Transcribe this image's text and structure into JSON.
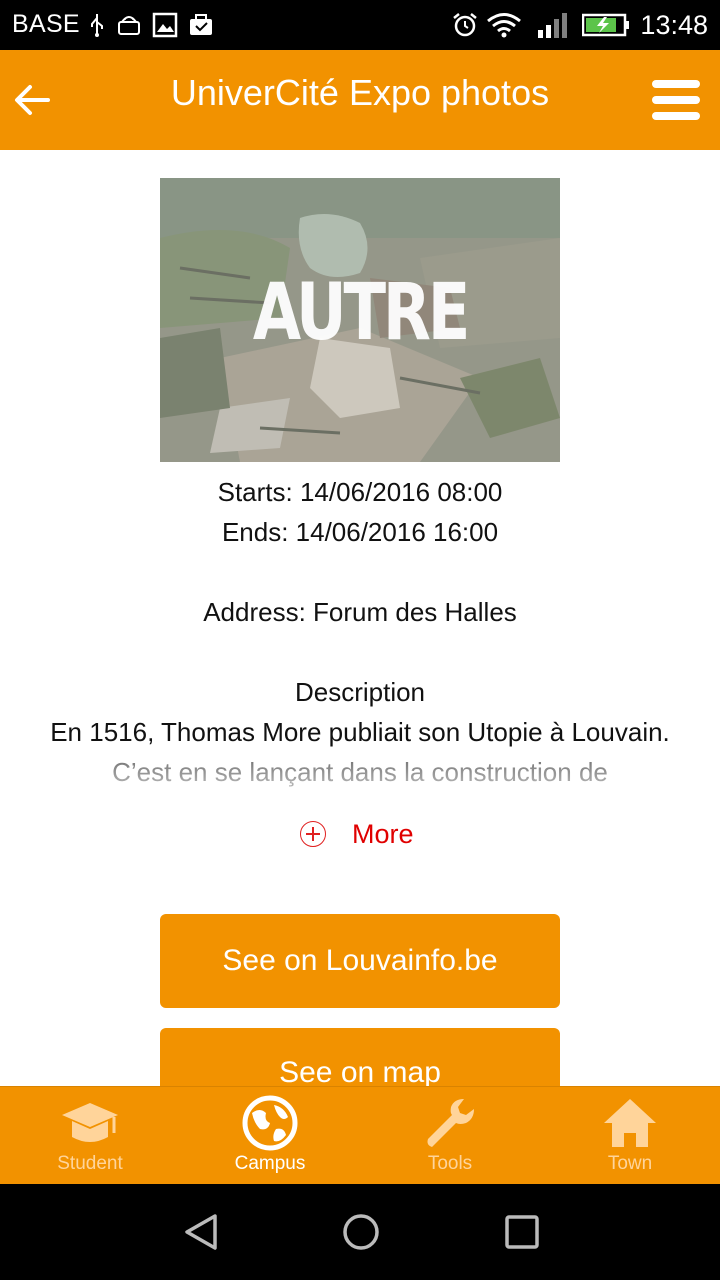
{
  "status_bar": {
    "carrier": "BASE",
    "time": "13:48",
    "icons": [
      "usb-icon",
      "android-icon",
      "image-icon",
      "briefcase-icon",
      "alarm-icon",
      "wifi-icon",
      "signal-icon",
      "battery-charging-icon"
    ]
  },
  "app_bar": {
    "title": "UniverCité Expo photos",
    "back_icon": "arrow-left-icon",
    "menu_icon": "hamburger-menu-icon"
  },
  "event": {
    "image_caption": "AUTRE",
    "starts": "Starts: 14/06/2016 08:00",
    "ends": "Ends: 14/06/2016 16:00",
    "address": "Address: Forum des Halles",
    "description_heading": "Description",
    "description_text": "En 1516, Thomas More publiait son Utopie à Louvain. C’est en se lançant dans la construction de",
    "more_label": "More"
  },
  "buttons": {
    "louvainfo": "See on Louvainfo.be",
    "map": "See on map"
  },
  "tabs": [
    {
      "label": "Student",
      "icon": "graduation-cap-icon",
      "active": false
    },
    {
      "label": "Campus",
      "icon": "globe-icon",
      "active": true
    },
    {
      "label": "Tools",
      "icon": "wrench-icon",
      "active": false
    },
    {
      "label": "Town",
      "icon": "home-icon",
      "active": false
    }
  ],
  "colors": {
    "accent": "#f29200",
    "more_red": "#e00000"
  }
}
